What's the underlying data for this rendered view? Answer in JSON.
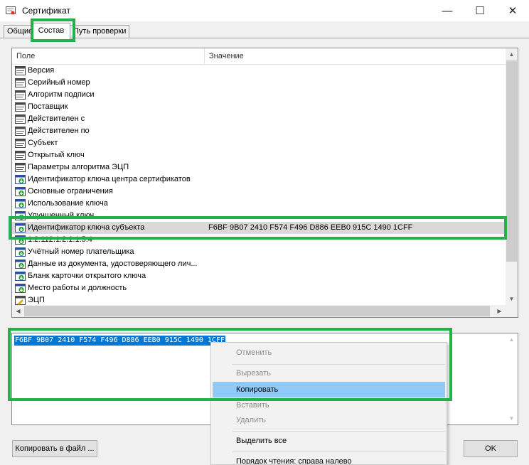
{
  "window": {
    "title": "Сертификат",
    "icon": "certificate-icon",
    "minimize": "—",
    "maximize": "☐",
    "close": "✕"
  },
  "tabs": [
    {
      "label": "Общие"
    },
    {
      "label": "Состав"
    },
    {
      "label": "Путь проверки"
    }
  ],
  "list": {
    "headers": {
      "field": "Поле",
      "value": "Значение"
    },
    "rows": [
      {
        "field": "Версия",
        "value": "",
        "icon": "field-icon"
      },
      {
        "field": "Серийный номер",
        "value": "",
        "icon": "field-icon"
      },
      {
        "field": "Алгоритм подписи",
        "value": "",
        "icon": "field-icon"
      },
      {
        "field": "Поставщик",
        "value": "",
        "icon": "field-icon"
      },
      {
        "field": "Действителен  с",
        "value": "",
        "icon": "field-icon"
      },
      {
        "field": "Действителен по",
        "value": "",
        "icon": "field-icon"
      },
      {
        "field": "Субъект",
        "value": "",
        "icon": "field-icon"
      },
      {
        "field": "Открытый ключ",
        "value": "",
        "icon": "field-icon"
      },
      {
        "field": "Параметры алгоритма ЭЦП",
        "value": "",
        "icon": "field-icon"
      },
      {
        "field": "Идентификатор ключа центра сертификатов",
        "value": "",
        "icon": "extension-icon"
      },
      {
        "field": "Основные ограничения",
        "value": "",
        "icon": "extension-icon"
      },
      {
        "field": "Использование ключа",
        "value": "",
        "icon": "extension-icon"
      },
      {
        "field": "Улучшенный ключ",
        "value": "",
        "icon": "extension-icon"
      },
      {
        "field": "Идентификатор ключа субъекта",
        "value": "F6BF 9B07 2410 F574 F496 D886 EEB0 915C 1490 1CFF",
        "icon": "extension-icon",
        "selected": true
      },
      {
        "field": "1.2.112.1.2.1.1.5.4",
        "value": "",
        "icon": "extension-icon"
      },
      {
        "field": "Учётный номер плательщика",
        "value": "",
        "icon": "extension-icon"
      },
      {
        "field": "Данные из документа, удостоверяющего лич...",
        "value": "",
        "icon": "extension-icon"
      },
      {
        "field": "Бланк карточки открытого ключа",
        "value": "",
        "icon": "extension-icon"
      },
      {
        "field": "Место работы и должность",
        "value": "",
        "icon": "extension-icon"
      },
      {
        "field": "ЭЦП",
        "value": "",
        "icon": "signature-icon"
      }
    ]
  },
  "detail": {
    "value": "F6BF 9B07 2410 F574 F496 D886 EEB0 915C 1490 1CFF"
  },
  "buttons": {
    "copy_to_file": "Копировать в файл ...",
    "ok": "OK"
  },
  "context_menu": {
    "items": [
      {
        "label": "Отменить",
        "enabled": false
      },
      {
        "label": "Вырезать",
        "enabled": false
      },
      {
        "label": "Копировать",
        "enabled": true,
        "highlighted": true
      },
      {
        "label": "Вставить",
        "enabled": false
      },
      {
        "label": "Удалить",
        "enabled": false
      },
      {
        "label": "Выделить все",
        "enabled": true
      },
      {
        "label": "Порядок чтения: справа налево",
        "enabled": true
      }
    ]
  },
  "colors": {
    "highlight_box": "#22b14c",
    "selection": "#0078d7",
    "menu_hover": "#91c9f7"
  }
}
